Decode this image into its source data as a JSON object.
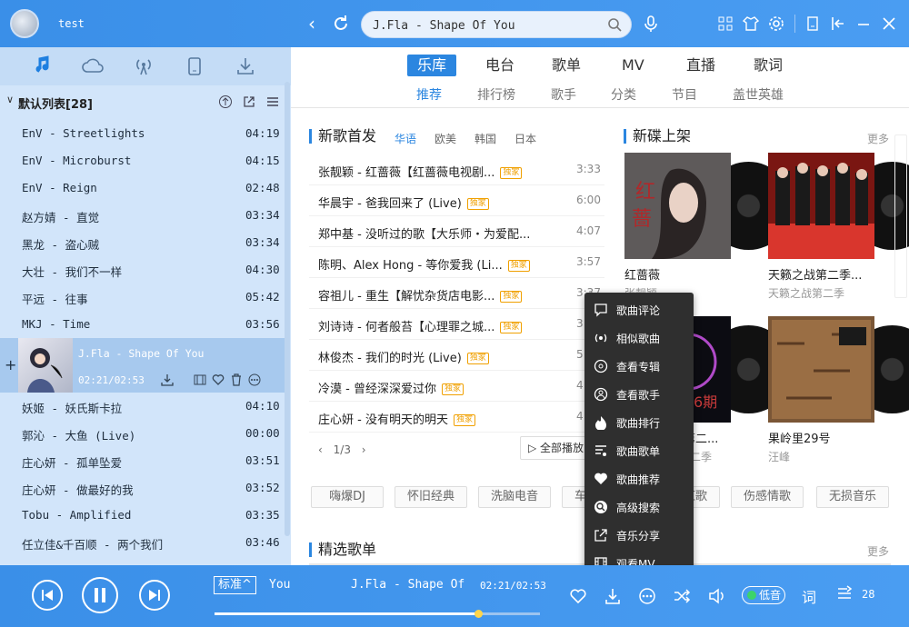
{
  "user": {
    "name": "test"
  },
  "search": {
    "value": "J.Fla - Shape Of You"
  },
  "sidebar": {
    "list_title": "默认列表[28]",
    "songs_before": [
      {
        "name": "EnV - Streetlights",
        "dur": "04:19"
      },
      {
        "name": "EnV - Microburst",
        "dur": "04:15"
      },
      {
        "name": "EnV - Reign",
        "dur": "02:48"
      },
      {
        "name": "赵方婧 - 直觉",
        "dur": "03:34"
      },
      {
        "name": "黑龙 - 盗心贼",
        "dur": "03:34"
      },
      {
        "name": "大壮 - 我们不一样",
        "dur": "04:30"
      },
      {
        "name": "平远 - 往事",
        "dur": "05:42"
      },
      {
        "name": "MKJ - Time",
        "dur": "03:56"
      }
    ],
    "now_playing": {
      "name": "J.Fla - Shape Of You",
      "time": "02:21/02:53"
    },
    "songs_after": [
      {
        "name": "妖姬 - 妖氏斯卡拉",
        "dur": "04:10"
      },
      {
        "name": "郭沁 - 大鱼 (Live)",
        "dur": "00:00"
      },
      {
        "name": "庄心妍 - 孤单坠爱",
        "dur": "03:51"
      },
      {
        "name": "庄心妍 - 做最好的我",
        "dur": "03:52"
      },
      {
        "name": "Tobu - Amplified",
        "dur": "03:35"
      },
      {
        "name": "任立佳&千百顺 - 两个我们",
        "dur": "03:46"
      }
    ]
  },
  "main": {
    "tabs": [
      "乐库",
      "电台",
      "歌单",
      "MV",
      "直播",
      "歌词"
    ],
    "subtabs": [
      "推荐",
      "排行榜",
      "歌手",
      "分类",
      "节目",
      "盖世英雄"
    ],
    "new_songs_title": "新歌首发",
    "filters": [
      "华语",
      "欧美",
      "韩国",
      "日本"
    ],
    "new_songs": [
      {
        "name": "张靓颖 - 红蔷薇【红蔷薇电视剧...",
        "tag": "独家",
        "dur": "3:33"
      },
      {
        "name": "华晨宇 - 爸我回来了 (Live)",
        "tag": "独家",
        "dur": "6:00"
      },
      {
        "name": "郑中基 - 没听过的歌【大乐师・为爱配...",
        "tag": "",
        "dur": "4:07"
      },
      {
        "name": "陈明、Alex Hong - 等你爱我 (Li...",
        "tag": "独家",
        "dur": "3:57"
      },
      {
        "name": "容祖儿 - 重生【解忧杂货店电影...",
        "tag": "独家",
        "dur": "3:37"
      },
      {
        "name": "刘诗诗 - 何者般苔【心理罪之城...",
        "tag": "独家",
        "dur": "3:01"
      },
      {
        "name": "林俊杰 - 我们的时光 (Live)",
        "tag": "独家",
        "dur": "5:08"
      },
      {
        "name": "冷漠 - 曾经深深爱过你",
        "tag": "独家",
        "dur": "4:10"
      },
      {
        "name": "庄心妍 - 没有明天的明天",
        "tag": "独家",
        "dur": "4:32"
      }
    ],
    "pager": "1/3",
    "play_all": "全部播放",
    "new_albums_title": "新碟上架",
    "more": "更多",
    "albums": [
      {
        "title": "红蔷薇",
        "artist": "张靓颖"
      },
      {
        "title": "天籁之战第二季...",
        "artist": "天籁之战第二季"
      },
      {
        "title": "梦想的声音第二...",
        "artist": "梦想的声音第二季"
      },
      {
        "title": "果岭里29号",
        "artist": "汪峰"
      }
    ],
    "chips": [
      "嗨爆DJ",
      "怀旧经典",
      "洗脑电音",
      "网络红歌",
      "伤感情歌",
      "无损音乐"
    ],
    "chip_partial": "车载音乐",
    "featured_title": "精选歌单",
    "featured_more": "更多"
  },
  "context_menu": [
    {
      "icon": "comment-icon",
      "label": "歌曲评论"
    },
    {
      "icon": "similar-icon",
      "label": "相似歌曲"
    },
    {
      "icon": "album-icon",
      "label": "查看专辑"
    },
    {
      "icon": "singer-icon",
      "label": "查看歌手"
    },
    {
      "icon": "hot-icon",
      "label": "歌曲排行"
    },
    {
      "icon": "playlist-icon",
      "label": "歌曲歌单"
    },
    {
      "icon": "heart-icon",
      "label": "歌曲推荐"
    },
    {
      "icon": "search-icon",
      "label": "高级搜索"
    },
    {
      "icon": "share-icon",
      "label": "音乐分享"
    },
    {
      "icon": "mv-icon",
      "label": "观看MV"
    }
  ],
  "player": {
    "quality": "标准",
    "title_fragment": "You",
    "title": "J.Fla - Shape Of",
    "time": "02:21/02:53",
    "progress": 0.81,
    "effect": "低音",
    "lyric_btn": "词",
    "count": "28"
  }
}
